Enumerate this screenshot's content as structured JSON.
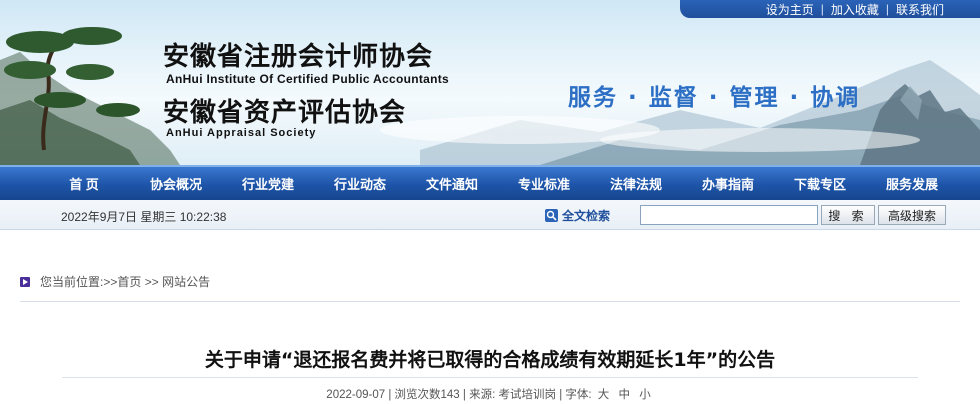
{
  "top_links": [
    "设为主页",
    "加入收藏",
    "联系我们"
  ],
  "org": {
    "name_cn_1": "安徽省注册会计师协会",
    "name_en_1": "AnHui Institute Of Certified Public Accountants",
    "name_cn_2": "安徽省资产评估协会",
    "name_en_2": "AnHui Appraisal Society",
    "slogan": "服务 · 监督 · 管理 · 协调"
  },
  "nav": [
    "首  页",
    "协会概况",
    "行业党建",
    "行业动态",
    "文件通知",
    "专业标准",
    "法律法规",
    "办事指南",
    "下载专区",
    "服务发展"
  ],
  "util": {
    "datetime": "2022年9月7日 星期三 10:22:38",
    "fulltext_label": "全文检索",
    "search_placeholder": "",
    "search_button": "搜 索",
    "advanced_button": "高级搜索"
  },
  "breadcrumb": {
    "prefix": "您当前位置:>>",
    "home": "首页",
    "sep": ">>",
    "section": "网站公告"
  },
  "article": {
    "title": "关于申请“退还报名费并将已取得的合格成绩有效期延长1年”的公告",
    "date": "2022-09-07",
    "views_label": "浏览次数",
    "views": "143",
    "source_label": "来源:",
    "source": "考试培训岗",
    "font_label": "字体:",
    "font_sizes": [
      "大",
      "中",
      "小"
    ]
  },
  "colors": {
    "nav_blue": "#1d54a8",
    "slogan_blue": "#2c6fc4",
    "marker_purple": "#4a2f9b"
  }
}
